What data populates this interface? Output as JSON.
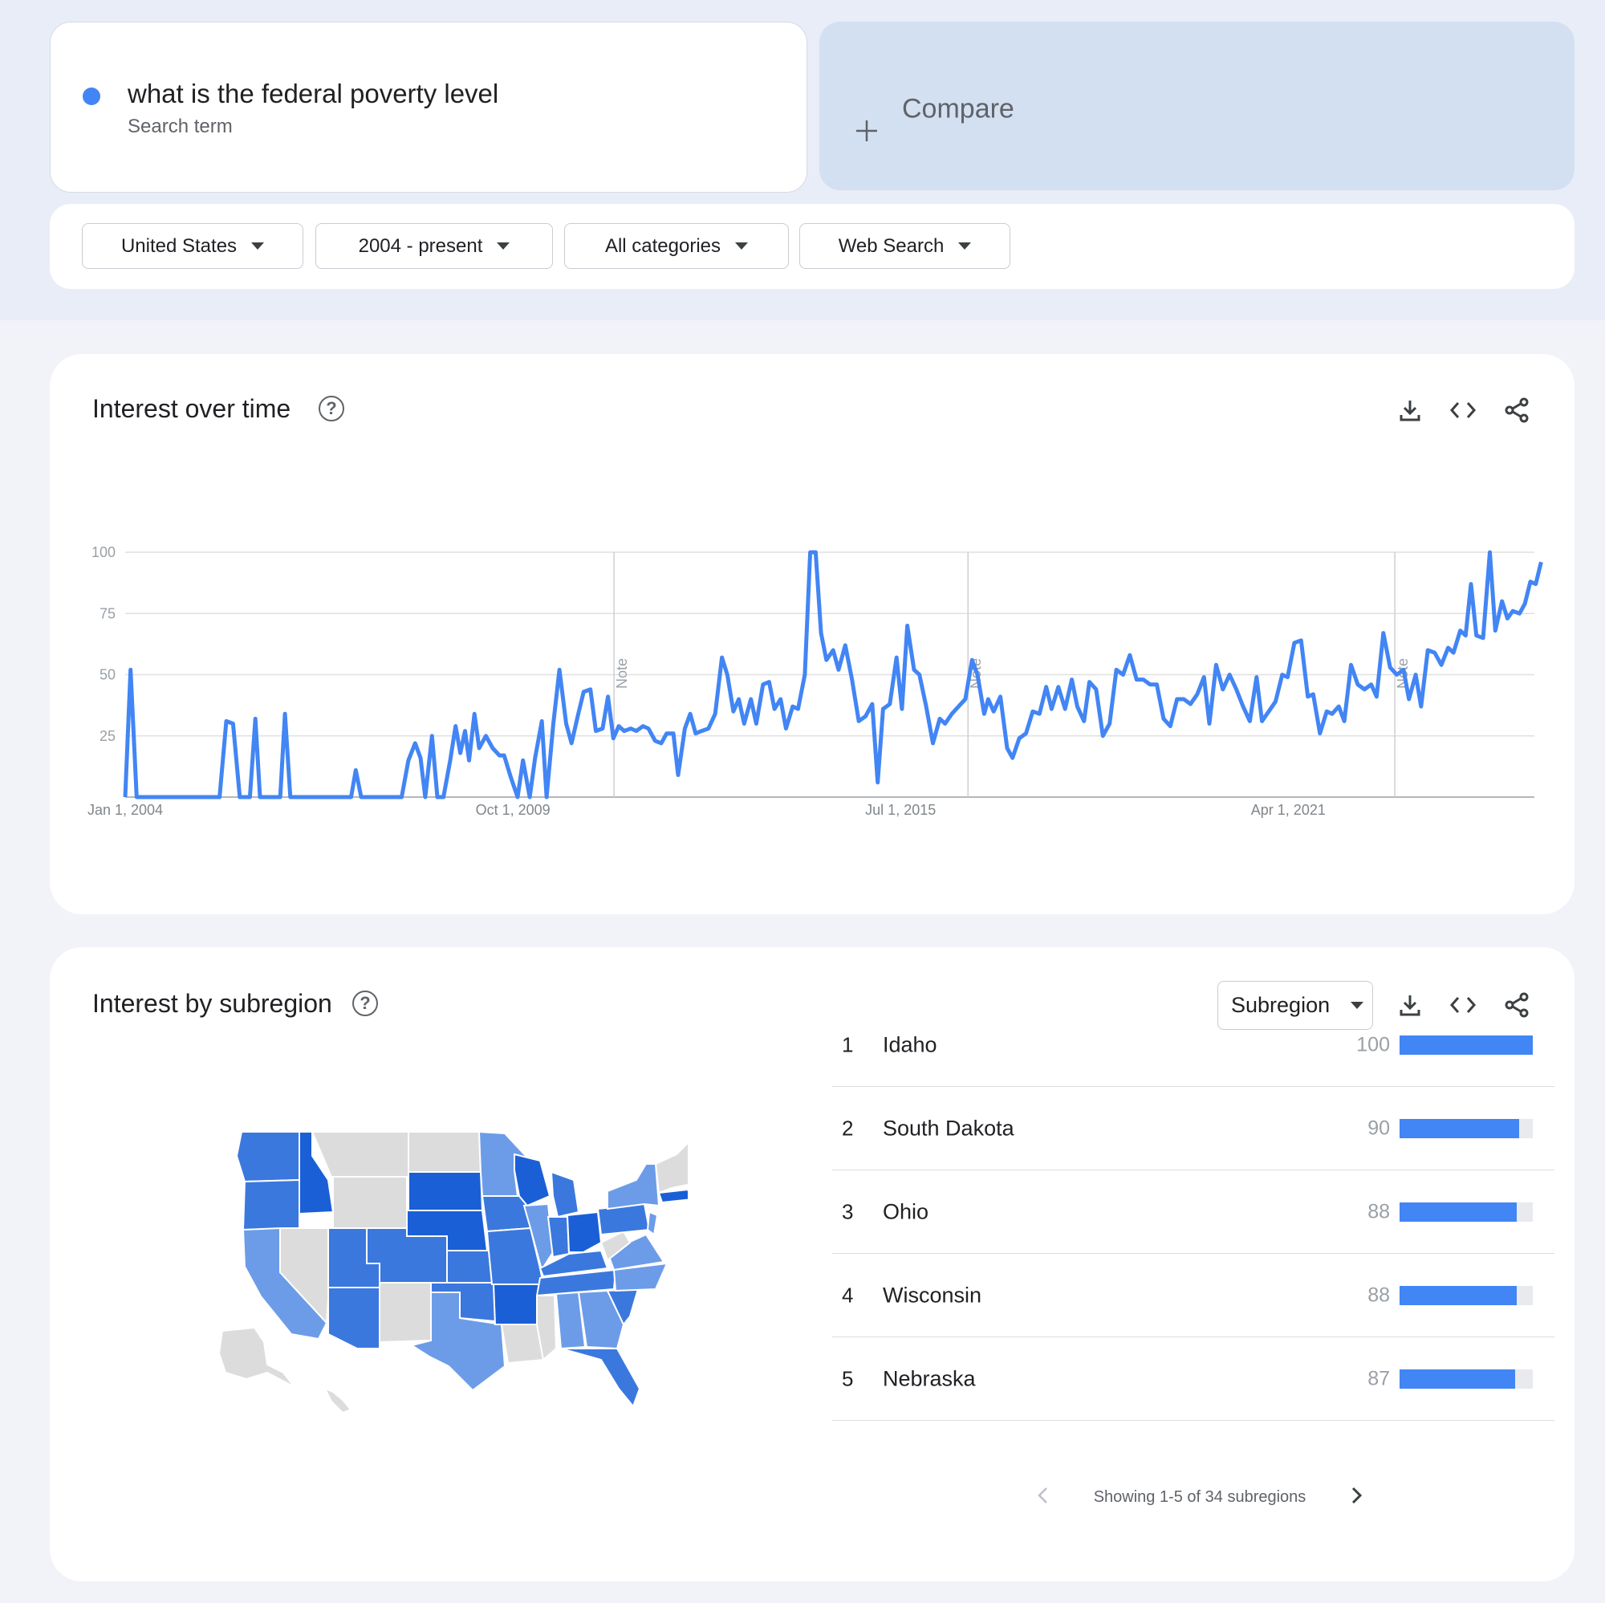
{
  "search": {
    "term": "what is the federal poverty level",
    "term_sublabel": "Search term",
    "term_color": "#4285f4",
    "compare_label": "Compare"
  },
  "filters": {
    "region": "United States",
    "period": "2004 - present",
    "category": "All categories",
    "search_type": "Web Search"
  },
  "interest_over_time": {
    "title": "Interest over time",
    "note_label": "Note",
    "icons": [
      "help-icon",
      "download-icon",
      "embed-icon",
      "share-icon"
    ]
  },
  "chart_data": {
    "type": "line",
    "x_tick_labels": [
      "Jan 1, 2004",
      "Oct 1, 2009",
      "Jul 1, 2015",
      "Apr 1, 2021"
    ],
    "y_tick_labels": [
      "100",
      "75",
      "50",
      "25"
    ],
    "ylim": [
      0,
      100
    ],
    "xlim": [
      2004.0,
      2024.9
    ],
    "grid": true,
    "note_positions": [
      2011.25,
      2016.5,
      2022.83
    ],
    "series": [
      {
        "color": "#4285f4",
        "points": [
          [
            2004.0,
            0
          ],
          [
            2004.08,
            52
          ],
          [
            2004.17,
            0
          ],
          [
            2004.5,
            0
          ],
          [
            2005.0,
            0
          ],
          [
            2005.4,
            0
          ],
          [
            2005.5,
            31
          ],
          [
            2005.6,
            30
          ],
          [
            2005.7,
            0
          ],
          [
            2005.85,
            0
          ],
          [
            2005.93,
            32
          ],
          [
            2006.0,
            0
          ],
          [
            2006.3,
            0
          ],
          [
            2006.37,
            34
          ],
          [
            2006.45,
            0
          ],
          [
            2006.8,
            0
          ],
          [
            2007.2,
            0
          ],
          [
            2007.35,
            0
          ],
          [
            2007.42,
            11
          ],
          [
            2007.5,
            0
          ],
          [
            2008.0,
            0
          ],
          [
            2008.1,
            0
          ],
          [
            2008.2,
            15
          ],
          [
            2008.3,
            22
          ],
          [
            2008.38,
            16
          ],
          [
            2008.45,
            0
          ],
          [
            2008.55,
            25
          ],
          [
            2008.63,
            0
          ],
          [
            2008.72,
            0
          ],
          [
            2008.82,
            15
          ],
          [
            2008.9,
            29
          ],
          [
            2008.97,
            18
          ],
          [
            2009.04,
            27
          ],
          [
            2009.1,
            15
          ],
          [
            2009.18,
            34
          ],
          [
            2009.25,
            20
          ],
          [
            2009.35,
            25
          ],
          [
            2009.45,
            20
          ],
          [
            2009.55,
            17
          ],
          [
            2009.62,
            17
          ],
          [
            2009.72,
            8
          ],
          [
            2009.82,
            0
          ],
          [
            2009.9,
            15
          ],
          [
            2010.0,
            0
          ],
          [
            2010.08,
            16
          ],
          [
            2010.18,
            31
          ],
          [
            2010.25,
            0
          ],
          [
            2010.35,
            30
          ],
          [
            2010.44,
            52
          ],
          [
            2010.54,
            30
          ],
          [
            2010.62,
            22
          ],
          [
            2010.72,
            34
          ],
          [
            2010.8,
            43
          ],
          [
            2010.9,
            44
          ],
          [
            2010.98,
            27
          ],
          [
            2011.08,
            28
          ],
          [
            2011.16,
            41
          ],
          [
            2011.24,
            24
          ],
          [
            2011.32,
            29
          ],
          [
            2011.4,
            27
          ],
          [
            2011.5,
            28
          ],
          [
            2011.58,
            27
          ],
          [
            2011.68,
            29
          ],
          [
            2011.76,
            28
          ],
          [
            2011.86,
            23
          ],
          [
            2011.95,
            22
          ],
          [
            2012.03,
            26
          ],
          [
            2012.13,
            26
          ],
          [
            2012.2,
            9
          ],
          [
            2012.3,
            28
          ],
          [
            2012.38,
            34
          ],
          [
            2012.46,
            26
          ],
          [
            2012.55,
            27
          ],
          [
            2012.65,
            28
          ],
          [
            2012.75,
            34
          ],
          [
            2012.85,
            57
          ],
          [
            2012.93,
            50
          ],
          [
            2013.02,
            35
          ],
          [
            2013.1,
            40
          ],
          [
            2013.18,
            30
          ],
          [
            2013.28,
            40
          ],
          [
            2013.36,
            30
          ],
          [
            2013.46,
            46
          ],
          [
            2013.55,
            47
          ],
          [
            2013.63,
            36
          ],
          [
            2013.72,
            40
          ],
          [
            2013.8,
            28
          ],
          [
            2013.9,
            37
          ],
          [
            2013.98,
            36
          ],
          [
            2014.08,
            50
          ],
          [
            2014.16,
            100
          ],
          [
            2014.24,
            100
          ],
          [
            2014.32,
            67
          ],
          [
            2014.4,
            56
          ],
          [
            2014.5,
            60
          ],
          [
            2014.58,
            52
          ],
          [
            2014.68,
            62
          ],
          [
            2014.78,
            48
          ],
          [
            2014.88,
            31
          ],
          [
            2014.98,
            33
          ],
          [
            2015.08,
            38
          ],
          [
            2015.16,
            6
          ],
          [
            2015.24,
            36
          ],
          [
            2015.34,
            38
          ],
          [
            2015.44,
            57
          ],
          [
            2015.52,
            36
          ],
          [
            2015.6,
            70
          ],
          [
            2015.7,
            52
          ],
          [
            2015.78,
            50
          ],
          [
            2015.88,
            37
          ],
          [
            2015.98,
            22
          ],
          [
            2016.08,
            32
          ],
          [
            2016.16,
            30
          ],
          [
            2016.26,
            34
          ],
          [
            2016.36,
            37
          ],
          [
            2016.46,
            40
          ],
          [
            2016.56,
            56
          ],
          [
            2016.64,
            50
          ],
          [
            2016.74,
            34
          ],
          [
            2016.8,
            40
          ],
          [
            2016.88,
            35
          ],
          [
            2016.98,
            41
          ],
          [
            2017.08,
            20
          ],
          [
            2017.16,
            16
          ],
          [
            2017.26,
            24
          ],
          [
            2017.36,
            26
          ],
          [
            2017.46,
            35
          ],
          [
            2017.56,
            34
          ],
          [
            2017.66,
            45
          ],
          [
            2017.74,
            36
          ],
          [
            2017.84,
            45
          ],
          [
            2017.94,
            36
          ],
          [
            2018.04,
            48
          ],
          [
            2018.12,
            37
          ],
          [
            2018.22,
            31
          ],
          [
            2018.3,
            47
          ],
          [
            2018.4,
            44
          ],
          [
            2018.5,
            25
          ],
          [
            2018.6,
            30
          ],
          [
            2018.7,
            52
          ],
          [
            2018.8,
            50
          ],
          [
            2018.9,
            58
          ],
          [
            2019.0,
            48
          ],
          [
            2019.1,
            48
          ],
          [
            2019.2,
            46
          ],
          [
            2019.3,
            46
          ],
          [
            2019.4,
            32
          ],
          [
            2019.5,
            29
          ],
          [
            2019.6,
            40
          ],
          [
            2019.7,
            40
          ],
          [
            2019.8,
            38
          ],
          [
            2019.9,
            42
          ],
          [
            2020.0,
            49
          ],
          [
            2020.08,
            30
          ],
          [
            2020.18,
            54
          ],
          [
            2020.28,
            44
          ],
          [
            2020.38,
            50
          ],
          [
            2020.48,
            44
          ],
          [
            2020.58,
            37
          ],
          [
            2020.68,
            31
          ],
          [
            2020.78,
            49
          ],
          [
            2020.86,
            31
          ],
          [
            2020.96,
            35
          ],
          [
            2021.06,
            39
          ],
          [
            2021.16,
            50
          ],
          [
            2021.24,
            49
          ],
          [
            2021.34,
            63
          ],
          [
            2021.44,
            64
          ],
          [
            2021.54,
            41
          ],
          [
            2021.62,
            42
          ],
          [
            2021.72,
            26
          ],
          [
            2021.82,
            35
          ],
          [
            2021.9,
            34
          ],
          [
            2022.0,
            37
          ],
          [
            2022.08,
            31
          ],
          [
            2022.18,
            54
          ],
          [
            2022.28,
            46
          ],
          [
            2022.38,
            44
          ],
          [
            2022.48,
            46
          ],
          [
            2022.56,
            41
          ],
          [
            2022.66,
            67
          ],
          [
            2022.76,
            53
          ],
          [
            2022.86,
            50
          ],
          [
            2022.96,
            52
          ],
          [
            2023.04,
            40
          ],
          [
            2023.14,
            50
          ],
          [
            2023.22,
            37
          ],
          [
            2023.32,
            60
          ],
          [
            2023.42,
            59
          ],
          [
            2023.52,
            54
          ],
          [
            2023.62,
            61
          ],
          [
            2023.7,
            59
          ],
          [
            2023.8,
            68
          ],
          [
            2023.88,
            66
          ],
          [
            2023.96,
            87
          ],
          [
            2024.04,
            66
          ],
          [
            2024.14,
            65
          ],
          [
            2024.24,
            100
          ],
          [
            2024.32,
            68
          ],
          [
            2024.42,
            80
          ],
          [
            2024.5,
            73
          ],
          [
            2024.58,
            76
          ],
          [
            2024.68,
            75
          ],
          [
            2024.76,
            79
          ],
          [
            2024.84,
            88
          ],
          [
            2024.92,
            87
          ],
          [
            2025.0,
            96
          ]
        ]
      }
    ]
  },
  "interest_by_subregion": {
    "title": "Interest by subregion",
    "resolution_select": "Subregion",
    "rows": [
      {
        "rank": "1",
        "name": "Idaho",
        "value": "100"
      },
      {
        "rank": "2",
        "name": "South Dakota",
        "value": "90"
      },
      {
        "rank": "3",
        "name": "Ohio",
        "value": "88"
      },
      {
        "rank": "4",
        "name": "Wisconsin",
        "value": "88"
      },
      {
        "rank": "5",
        "name": "Nebraska",
        "value": "87"
      }
    ],
    "pager_text": "Showing 1-5 of 34 subregions",
    "map_colors": {
      "high": "#1a5fd6",
      "mid": "#3b78de",
      "low": "#6c9ce8",
      "none": "#dcdcdc"
    }
  }
}
